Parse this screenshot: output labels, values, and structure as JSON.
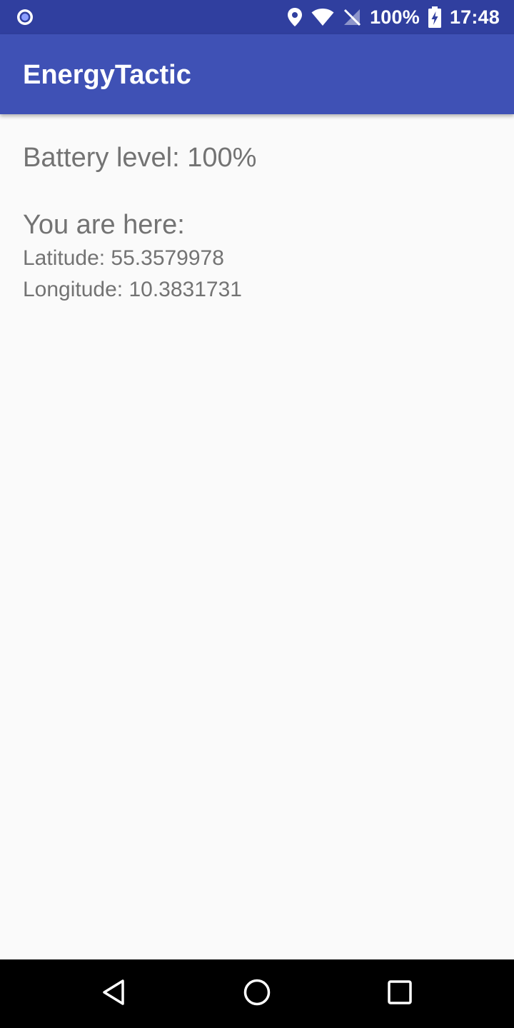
{
  "status_bar": {
    "battery_percent": "100%",
    "time": "17:48",
    "icons": [
      "notification-circle-icon",
      "location-pin-icon",
      "wifi-icon",
      "no-signal-icon",
      "battery-charging-icon"
    ]
  },
  "app_bar": {
    "title": "EnergyTactic"
  },
  "main": {
    "battery_level": "Battery level: 100%",
    "location_heading": "You are here:",
    "latitude": "Latitude: 55.3579978",
    "longitude": "Longitude: 10.3831731"
  },
  "nav_bar": {
    "buttons": [
      "back-icon",
      "home-icon",
      "recents-icon"
    ]
  },
  "colors": {
    "status_bar": "#303f9f",
    "app_bar": "#3f51b5",
    "background": "#fafafa",
    "text": "#737373"
  }
}
